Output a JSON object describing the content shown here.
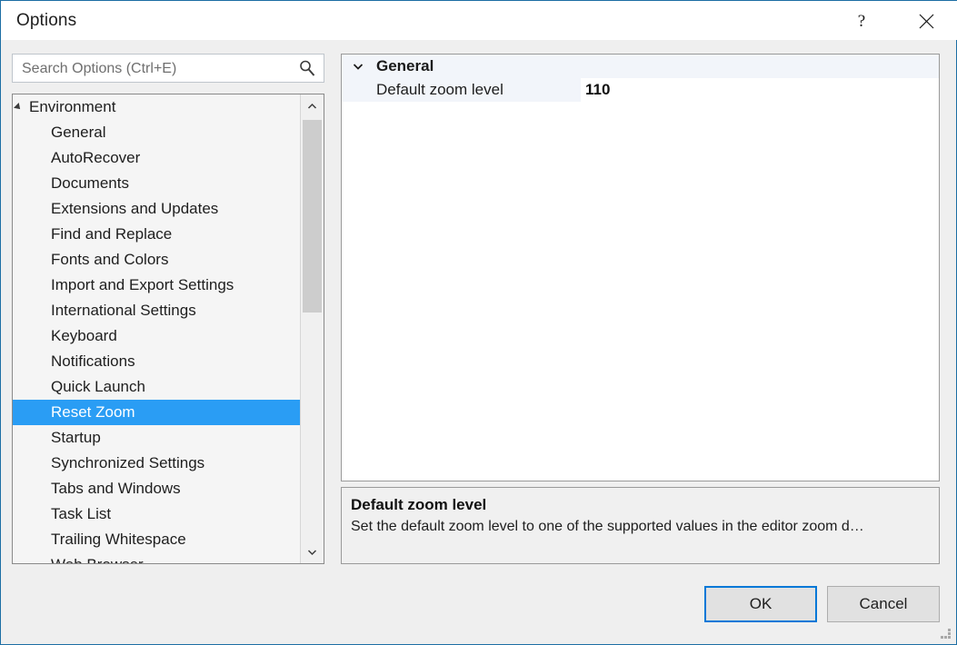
{
  "window": {
    "title": "Options",
    "help_icon": "question-mark-icon",
    "close_icon": "close-icon",
    "border_color": "#1c6ea4"
  },
  "search": {
    "placeholder": "Search Options (Ctrl+E)",
    "value": "",
    "icon": "search-icon"
  },
  "tree": {
    "root": {
      "label": "Environment",
      "expanded": true,
      "expander_icon": "triangle-expanded-icon"
    },
    "items": [
      {
        "label": "General",
        "selected": false
      },
      {
        "label": "AutoRecover",
        "selected": false
      },
      {
        "label": "Documents",
        "selected": false
      },
      {
        "label": "Extensions and Updates",
        "selected": false
      },
      {
        "label": "Find and Replace",
        "selected": false
      },
      {
        "label": "Fonts and Colors",
        "selected": false
      },
      {
        "label": "Import and Export Settings",
        "selected": false
      },
      {
        "label": "International Settings",
        "selected": false
      },
      {
        "label": "Keyboard",
        "selected": false
      },
      {
        "label": "Notifications",
        "selected": false
      },
      {
        "label": "Quick Launch",
        "selected": false
      },
      {
        "label": "Reset Zoom",
        "selected": true
      },
      {
        "label": "Startup",
        "selected": false
      },
      {
        "label": "Synchronized Settings",
        "selected": false
      },
      {
        "label": "Tabs and Windows",
        "selected": false
      },
      {
        "label": "Task List",
        "selected": false
      },
      {
        "label": "Trailing Whitespace",
        "selected": false
      },
      {
        "label": "Web Browser",
        "selected": false
      }
    ],
    "selection_color": "#2a9df4",
    "scrollbar": {
      "up_icon": "chevron-up-icon",
      "down_icon": "chevron-down-icon"
    }
  },
  "grid": {
    "category": {
      "label": "General",
      "expanded": true,
      "chevron_icon": "chevron-down-icon"
    },
    "rows": [
      {
        "name": "Default zoom level",
        "value": "110"
      }
    ]
  },
  "description": {
    "title": "Default zoom level",
    "text": "Set the default zoom level to one of the supported values in the editor zoom d…"
  },
  "buttons": {
    "ok": "OK",
    "cancel": "Cancel",
    "focus_color": "#0078d7"
  },
  "resize_grip_icon": "resize-grip-icon"
}
